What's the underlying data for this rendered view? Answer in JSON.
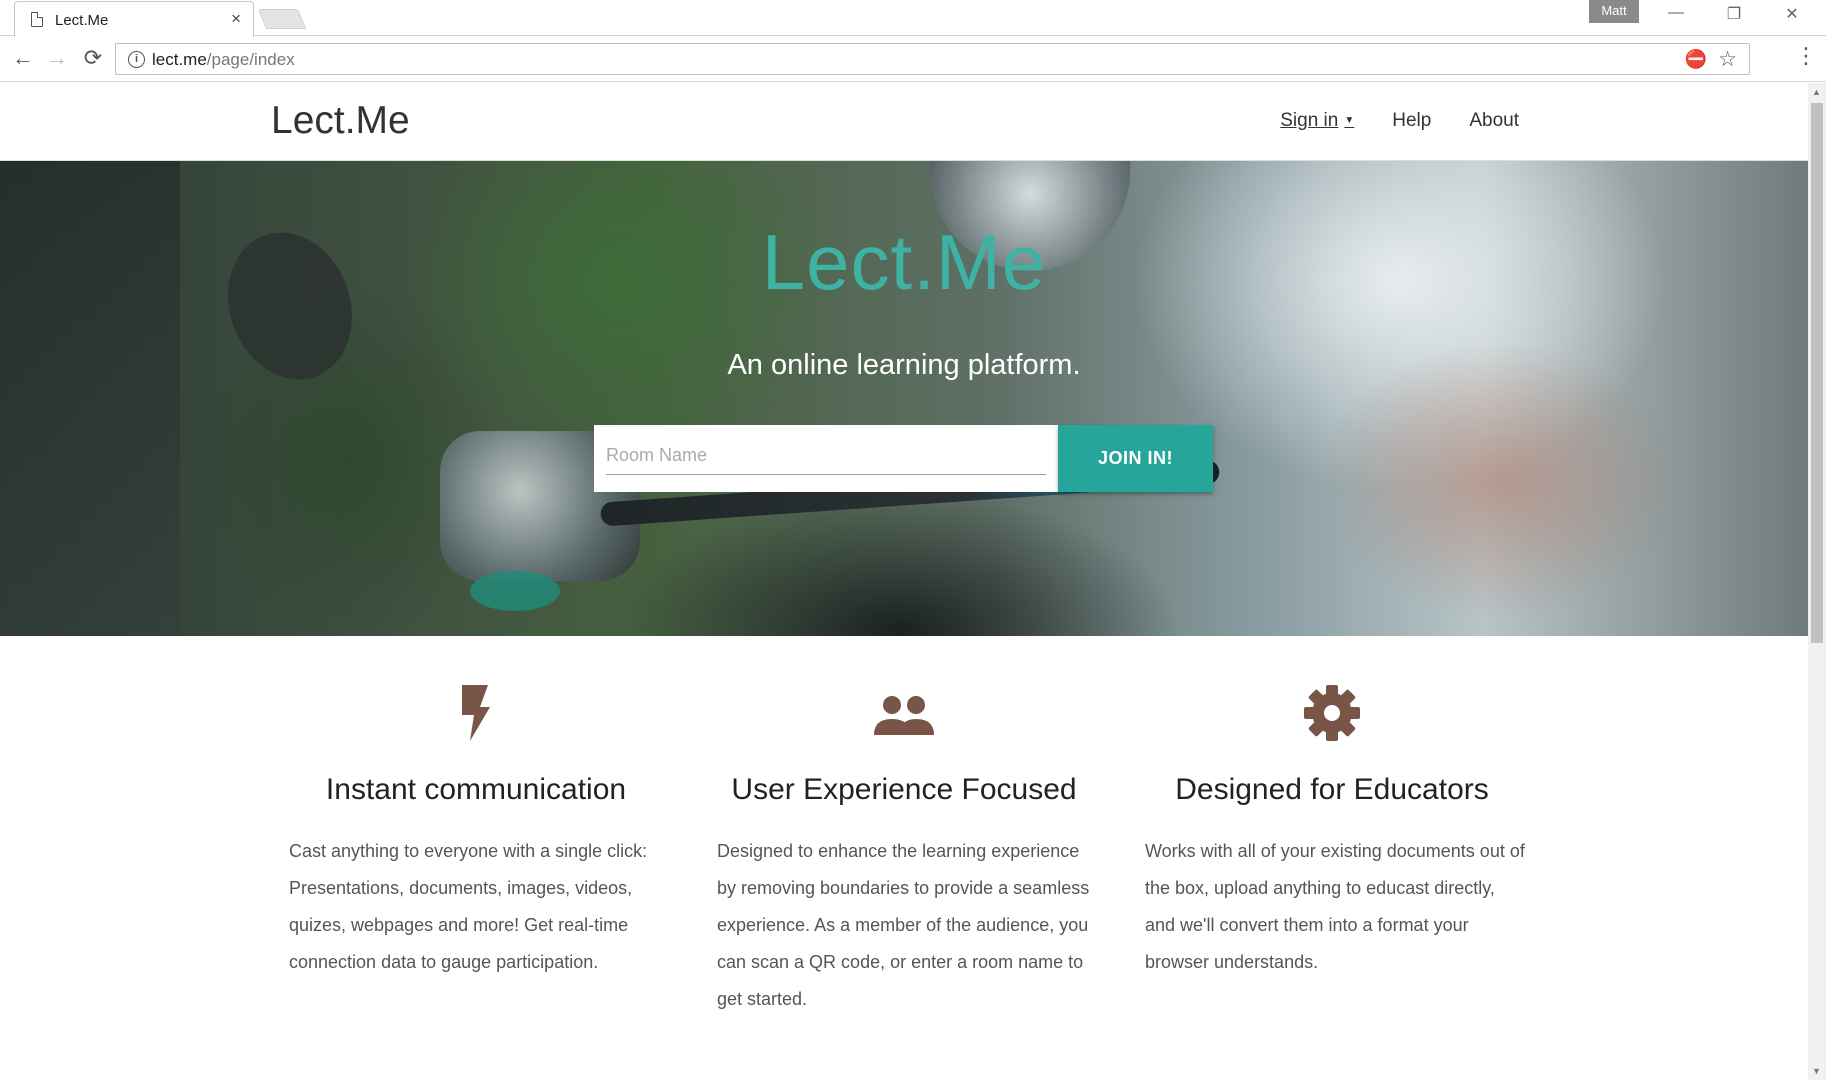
{
  "browser": {
    "tab_title": "Lect.Me",
    "tab_close": "×",
    "profile_name": "Matt",
    "window_minimize": "—",
    "window_restore": "❐",
    "window_close": "✕",
    "back": "←",
    "forward": "→",
    "reload": "⟳",
    "info_glyph": "i",
    "url_host": "lect.me",
    "url_path": "/page/index",
    "extension_icon": "⛔",
    "bookmark_star": "☆",
    "menu": "⋮"
  },
  "site_nav": {
    "brand": "Lect.Me",
    "sign_in": "Sign in",
    "sign_in_caret": "▼",
    "help": "Help",
    "about": "About"
  },
  "hero": {
    "title": "Lect.Me",
    "subtitle": "An online learning platform.",
    "room_placeholder": "Room Name",
    "room_value": "",
    "join_label": "JOIN IN!"
  },
  "features": [
    {
      "icon": "lightning-bolt",
      "title": "Instant communication",
      "text": "Cast anything to everyone with a single click: Presentations, documents, images, videos, quizes, webpages and more! Get real-time connection data to gauge participation."
    },
    {
      "icon": "people",
      "title": "User Experience Focused",
      "text": "Designed to enhance the learning experience by removing boundaries to provide a seamless experience. As a member of the audience, you can scan a QR code, or enter a room name to get started."
    },
    {
      "icon": "gear",
      "title": "Designed for Educators",
      "text": "Works with all of your existing documents out of the box, upload anything to educast directly, and we'll convert them into a format your browser understands."
    }
  ],
  "colors": {
    "accent": "#26a69a",
    "hero_title": "#3fb3a3",
    "icon_brown": "#795548"
  }
}
